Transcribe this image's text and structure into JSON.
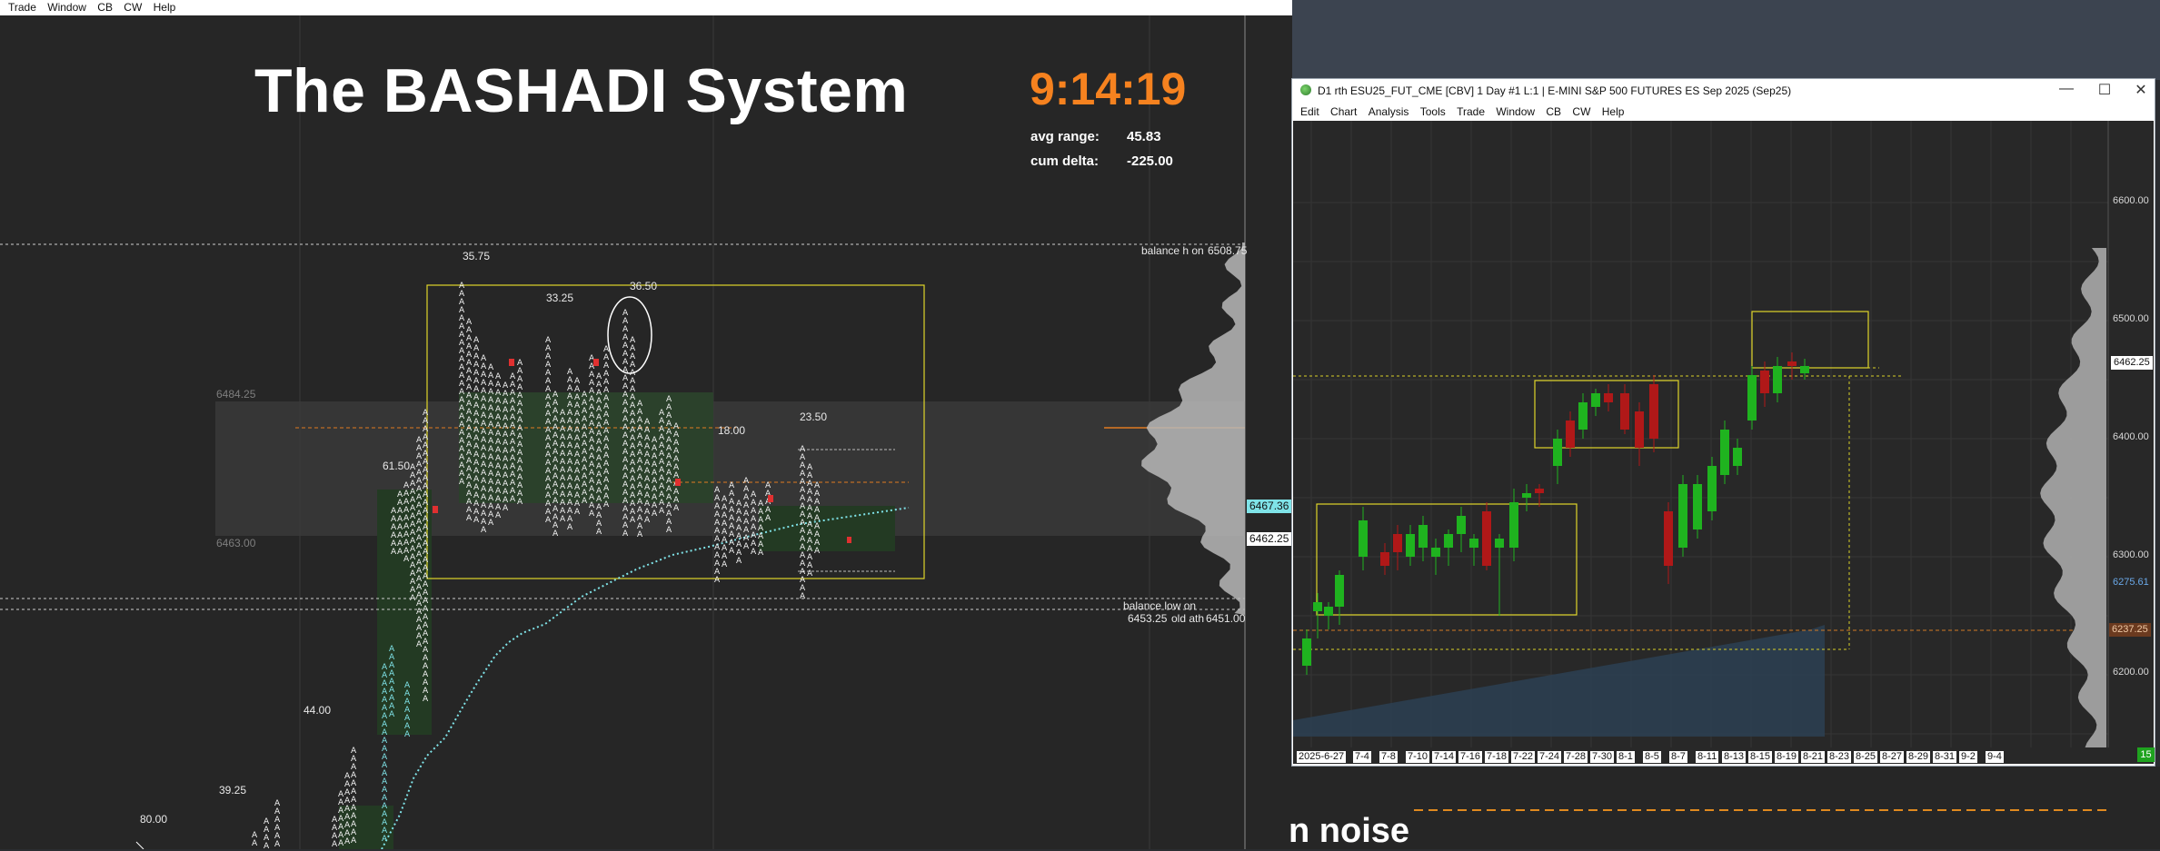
{
  "top_menu": [
    "Trade",
    "Window",
    "CB",
    "CW",
    "Help"
  ],
  "left_chart": {
    "title": "The BASHADI System",
    "clock": "9:14:19",
    "avg_range_label": "avg range:",
    "avg_range_value": "45.83",
    "cum_delta_label": "cum delta:",
    "cum_delta_value": "-225.00",
    "balance_high_label": "balance h on",
    "balance_high_value": "6508.75",
    "balance_low_label": "balance low on",
    "balance_low_value": "6453.25",
    "old_ath_label": "old ath",
    "old_ath_value": "6451.00",
    "value_area_high": "6484.25",
    "value_area_low": "6463.00",
    "price_tag_cyan": "6467.36",
    "price_tag_white": "6462.25",
    "range_labels": [
      "35.75",
      "33.25",
      "36.50",
      "18.00",
      "23.50",
      "61.50",
      "44.00",
      "39.25",
      "80.00"
    ],
    "tpo_letter": "A"
  },
  "right_window": {
    "title": "D1 rth ESU25_FUT_CME [CBV]  1 Day  #1 L:1 | E-MINI S&P 500 FUTURES ES Sep 2025 (Sep25)",
    "menu": [
      "Edit",
      "Chart",
      "Analysis",
      "Tools",
      "Trade",
      "Window",
      "CB",
      "CW",
      "Help"
    ],
    "price_axis": [
      "6600.00",
      "6500.00",
      "6400.00",
      "6300.00",
      "6200.00"
    ],
    "price_tag_current": "6462.25",
    "price_tag_blue": "6275.61",
    "price_tag_orange": "6237.25",
    "dates": [
      "2025-6-27",
      "7-4",
      "7-8",
      "7-10",
      "7-14",
      "7-16",
      "7-18",
      "7-22",
      "7-24",
      "7-28",
      "7-30",
      "8-1",
      "8-5",
      "8-7",
      "8-11",
      "8-13",
      "8-15",
      "8-19",
      "8-21",
      "8-23",
      "8-25",
      "8-27",
      "8-29",
      "8-31",
      "9-2",
      "9-4"
    ],
    "corner_badge": "15",
    "colors": {
      "up": "#1fb31f",
      "down": "#b01818",
      "box": "#e1d72a"
    }
  },
  "bottom_text": "n noise"
}
